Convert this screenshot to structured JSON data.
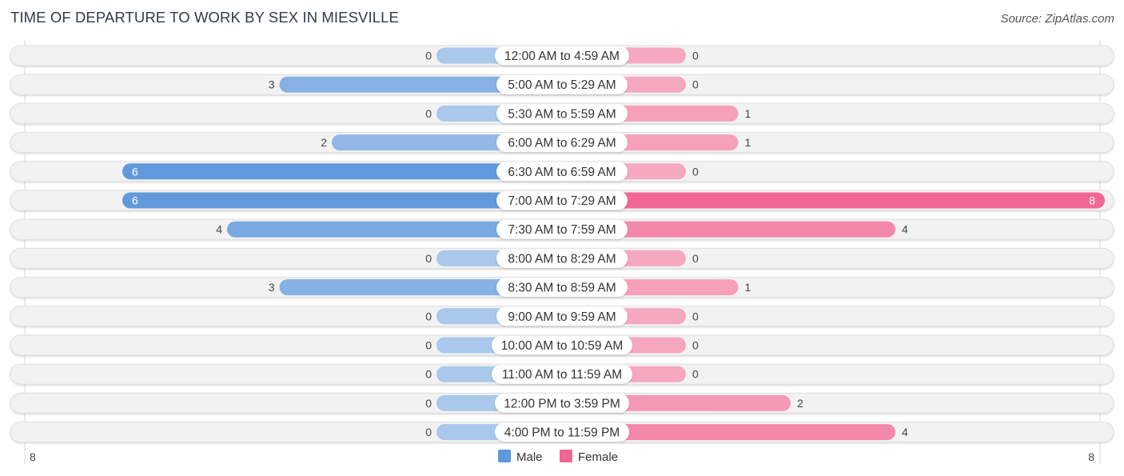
{
  "header": {
    "title": "TIME OF DEPARTURE TO WORK BY SEX IN MIESVILLE",
    "source": "Source: ZipAtlas.com"
  },
  "colors": {
    "male_strong": "#6199dc",
    "male_light": "#a9c8ec",
    "female_strong": "#f26792",
    "female_light": "#f6a8c1",
    "row_bg": "#f2f2f2"
  },
  "chart_data": {
    "type": "bar",
    "orientation": "horizontal-diverging",
    "title": "TIME OF DEPARTURE TO WORK BY SEX IN MIESVILLE",
    "categories": [
      "12:00 AM to 4:59 AM",
      "5:00 AM to 5:29 AM",
      "5:30 AM to 5:59 AM",
      "6:00 AM to 6:29 AM",
      "6:30 AM to 6:59 AM",
      "7:00 AM to 7:29 AM",
      "7:30 AM to 7:59 AM",
      "8:00 AM to 8:29 AM",
      "8:30 AM to 8:59 AM",
      "9:00 AM to 9:59 AM",
      "10:00 AM to 10:59 AM",
      "11:00 AM to 11:59 AM",
      "12:00 PM to 3:59 PM",
      "4:00 PM to 11:59 PM"
    ],
    "series": [
      {
        "name": "Male",
        "values": [
          0,
          3,
          0,
          2,
          6,
          6,
          4,
          0,
          3,
          0,
          0,
          0,
          0,
          0
        ]
      },
      {
        "name": "Female",
        "values": [
          0,
          0,
          1,
          1,
          0,
          8,
          4,
          0,
          1,
          0,
          0,
          0,
          2,
          4
        ]
      }
    ],
    "axis": {
      "left_tick": "8",
      "right_tick": "8",
      "max": 8
    },
    "legend": {
      "position": "bottom-center",
      "items": [
        "Male",
        "Female"
      ]
    }
  }
}
